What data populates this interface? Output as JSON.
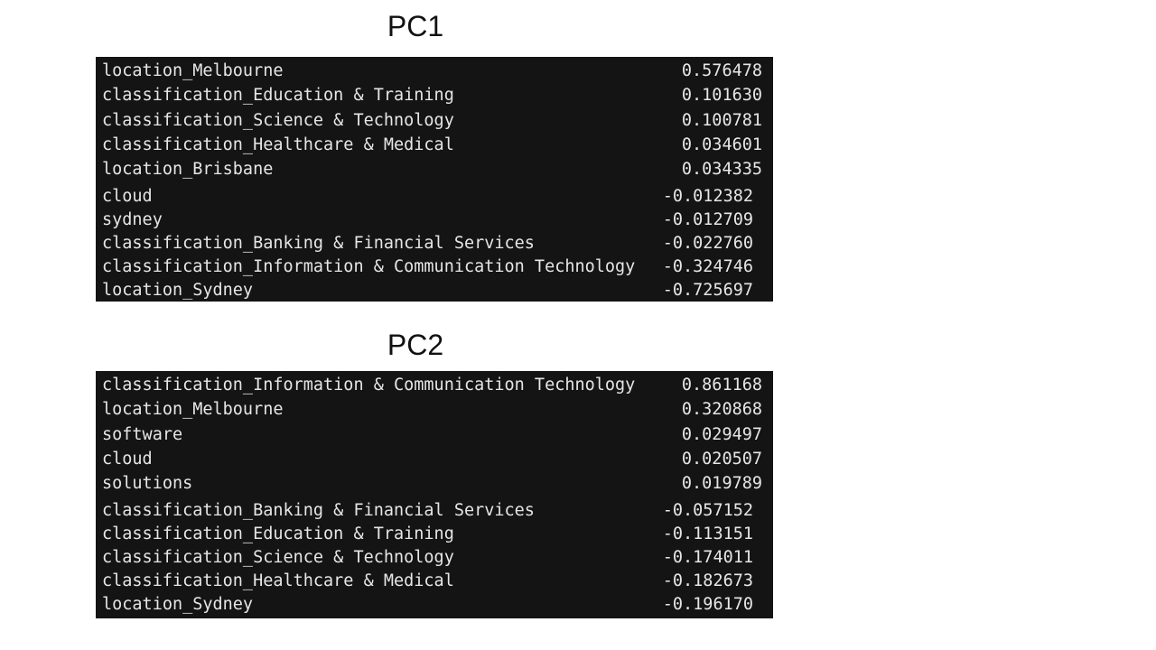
{
  "pc1": {
    "title": "PC1",
    "rows": [
      {
        "key": "location_Melbourne",
        "value": "0.576478"
      },
      {
        "key": "classification_Education & Training",
        "value": "0.101630"
      },
      {
        "key": "classification_Science & Technology",
        "value": "0.100781"
      },
      {
        "key": "classification_Healthcare & Medical",
        "value": "0.034601"
      },
      {
        "key": "location_Brisbane",
        "value": "0.034335"
      },
      {
        "key": "cloud",
        "value": "-0.012382"
      },
      {
        "key": "sydney",
        "value": "-0.012709"
      },
      {
        "key": "classification_Banking & Financial Services",
        "value": "-0.022760"
      },
      {
        "key": "classification_Information & Communication Technology",
        "value": "-0.324746"
      },
      {
        "key": "location_Sydney",
        "value": "-0.725697"
      }
    ]
  },
  "pc2": {
    "title": "PC2",
    "rows": [
      {
        "key": "classification_Information & Communication Technology",
        "value": "0.861168"
      },
      {
        "key": "location_Melbourne",
        "value": "0.320868"
      },
      {
        "key": "software",
        "value": "0.029497"
      },
      {
        "key": "cloud",
        "value": "0.020507"
      },
      {
        "key": "solutions",
        "value": "0.019789"
      },
      {
        "key": "classification_Banking & Financial Services",
        "value": "-0.057152"
      },
      {
        "key": "classification_Education & Training",
        "value": "-0.113151"
      },
      {
        "key": "classification_Science & Technology",
        "value": "-0.174011"
      },
      {
        "key": "classification_Healthcare & Medical",
        "value": "-0.182673"
      },
      {
        "key": "location_Sydney",
        "value": "-0.196170"
      }
    ]
  },
  "colors": {
    "table_background": "#141414",
    "table_text": "#e6e6e6",
    "title_text": "#111111"
  }
}
